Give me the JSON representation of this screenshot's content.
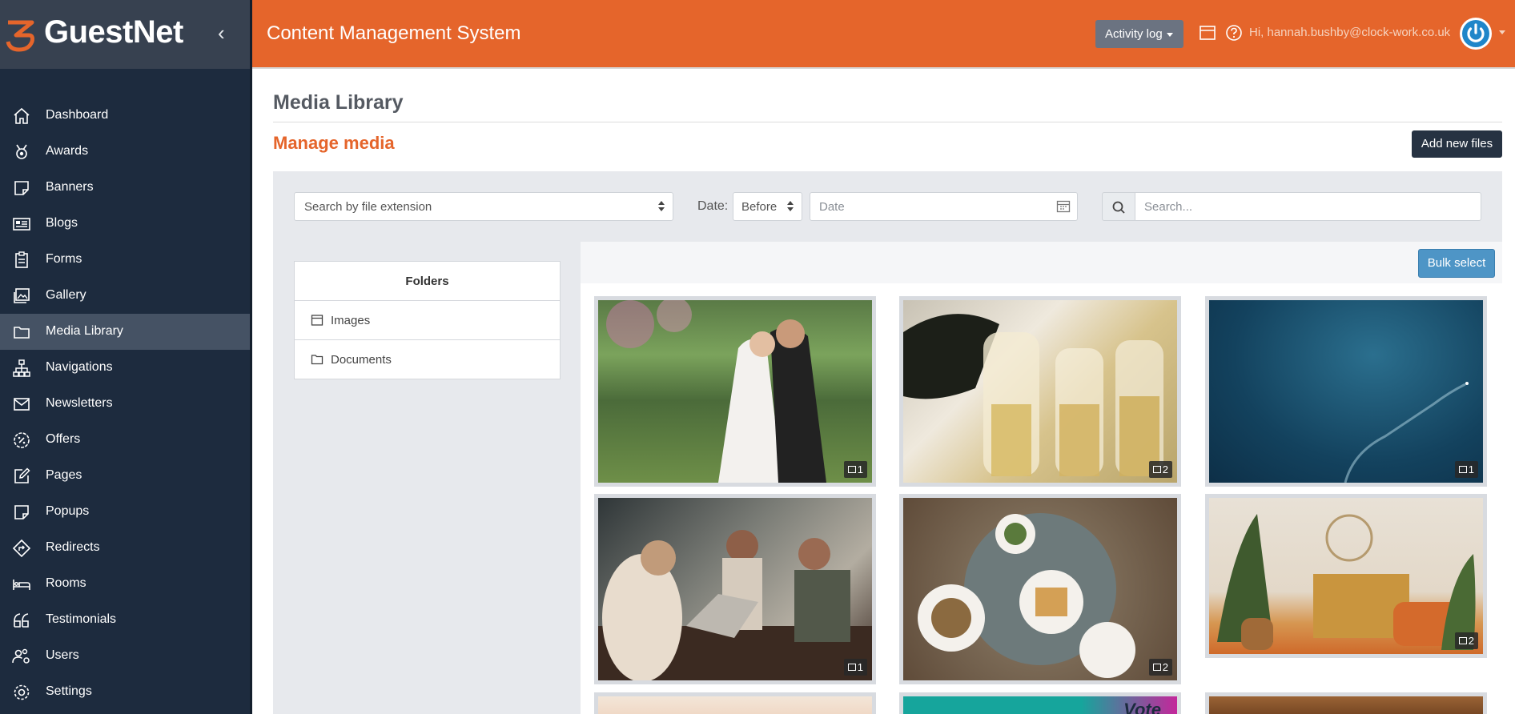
{
  "sidebar": {
    "brand_name": "GuestNet",
    "items": [
      {
        "label": "Dashboard",
        "icon": "home-icon"
      },
      {
        "label": "Awards",
        "icon": "award-icon"
      },
      {
        "label": "Banners",
        "icon": "note-icon"
      },
      {
        "label": "Blogs",
        "icon": "newspaper-icon"
      },
      {
        "label": "Forms",
        "icon": "clipboard-icon"
      },
      {
        "label": "Gallery",
        "icon": "images-icon"
      },
      {
        "label": "Media Library",
        "icon": "folder-icon",
        "active": true
      },
      {
        "label": "Navigations",
        "icon": "sitemap-icon"
      },
      {
        "label": "Newsletters",
        "icon": "envelope-icon"
      },
      {
        "label": "Offers",
        "icon": "badge-percent-icon"
      },
      {
        "label": "Pages",
        "icon": "edit-icon"
      },
      {
        "label": "Popups",
        "icon": "note-icon"
      },
      {
        "label": "Redirects",
        "icon": "directions-icon"
      },
      {
        "label": "Rooms",
        "icon": "bed-icon"
      },
      {
        "label": "Testimonials",
        "icon": "quote-icon"
      },
      {
        "label": "Users",
        "icon": "users-cog-icon"
      },
      {
        "label": "Settings",
        "icon": "gear-icon"
      }
    ]
  },
  "topbar": {
    "title": "Content Management System",
    "activity_label": "Activity log",
    "greeting": "Hi, hannah.bushby@clock-work.co.uk"
  },
  "main": {
    "page_title": "Media Library",
    "section_title": "Manage media",
    "add_button": "Add new files",
    "filters": {
      "extension_placeholder": "Search by file extension",
      "date_label": "Date:",
      "date_mode": "Before",
      "date_placeholder": "Date",
      "search_placeholder": "Search..."
    },
    "folders": {
      "header": "Folders",
      "items": [
        {
          "label": "Images",
          "icon": "image-folder-icon"
        },
        {
          "label": "Documents",
          "icon": "folder-icon"
        }
      ]
    },
    "bulk_select": "Bulk select",
    "media": [
      {
        "subject": "wedding couple",
        "count": "1"
      },
      {
        "subject": "champagne pour",
        "count": "2"
      },
      {
        "subject": "ocean aerial",
        "count": "1"
      },
      {
        "subject": "friends with laptop",
        "count": "1"
      },
      {
        "subject": "brunch table",
        "count": "2"
      },
      {
        "subject": "living room decor",
        "count": "2"
      },
      {
        "subject": "sunset",
        "count": ""
      },
      {
        "subject": "vote banner",
        "count": ""
      },
      {
        "subject": "wood ceiling",
        "count": ""
      }
    ],
    "vote_text": "Vote"
  },
  "colors": {
    "brand_orange": "#e5652b",
    "sidebar_bg": "#1d2b3e",
    "button_dark": "#263242",
    "button_blue": "#4e95c6"
  }
}
